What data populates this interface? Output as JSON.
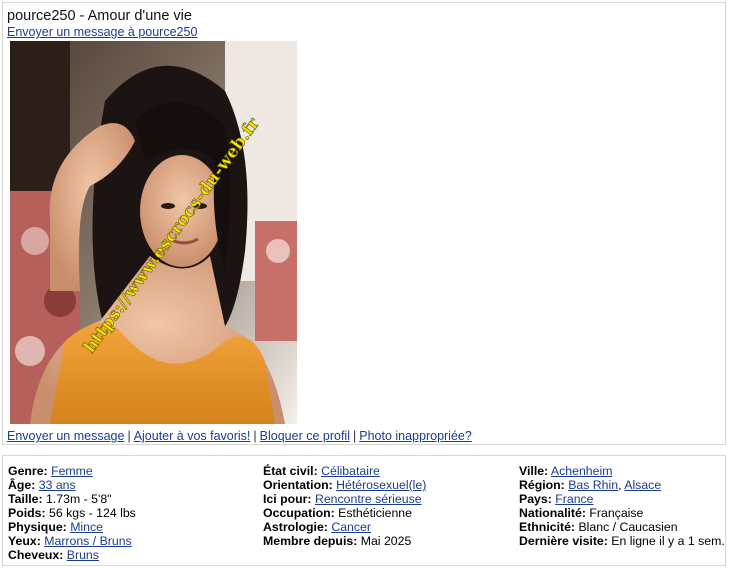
{
  "profile": {
    "username": "pource250",
    "headline": "Amour d'une vie",
    "title_sep": " - ",
    "send_message_link": "Envoyer un message à pource250",
    "watermark": "https://www.escrocs-du-web.fr"
  },
  "actions": {
    "send": "Envoyer un message",
    "favorite": "Ajouter à vos favoris!",
    "block": "Bloquer ce profil",
    "report": "Photo inappropriée?",
    "separator": "|"
  },
  "details": {
    "col1": [
      {
        "label": "Genre:",
        "value": "Femme",
        "link": true
      },
      {
        "label": "Âge:",
        "value": "33 ans",
        "link": true
      },
      {
        "label": "Taille:",
        "value": "1.73m - 5'8\"",
        "link": false
      },
      {
        "label": "Poids:",
        "value": "56 kgs - 124 lbs",
        "link": false
      },
      {
        "label": "Physique:",
        "value": "Mince",
        "link": true
      },
      {
        "label": "Yeux:",
        "value": "Marrons / Bruns",
        "link": true
      },
      {
        "label": "Cheveux:",
        "value": "Bruns",
        "link": true
      }
    ],
    "col2": [
      {
        "label": "État civil:",
        "value": "Célibataire",
        "link": true
      },
      {
        "label": "Orientation:",
        "value": "Hétérosexuel(le)",
        "link": true
      },
      {
        "label": "Ici pour:",
        "value": "Rencontre sérieuse",
        "link": true
      },
      {
        "label": "Occupation:",
        "value": "Esthéticienne",
        "link": false
      },
      {
        "label": "Astrologie:",
        "value": "Cancer",
        "link": true
      },
      {
        "label": "Membre depuis:",
        "value": "Mai 2025",
        "link": false
      }
    ],
    "col3_ville": {
      "label": "Ville:",
      "value": "Achenheim"
    },
    "col3_region": {
      "label": "Région:",
      "value1": "Bas Rhin",
      "sep": ", ",
      "value2": "Alsace"
    },
    "col3_rest": [
      {
        "label": "Pays:",
        "value": "France",
        "link": true
      },
      {
        "label": "Nationalité:",
        "value": "Française",
        "link": false
      },
      {
        "label": "Ethnicité:",
        "value": "Blanc / Caucasien",
        "link": false
      },
      {
        "label": "Dernière visite:",
        "value": "En ligne il y a 1 sem.",
        "link": false
      }
    ]
  },
  "colors": {
    "link": "#1a3d8f",
    "watermark": "#f2e600",
    "border": "#d8d8d8"
  }
}
